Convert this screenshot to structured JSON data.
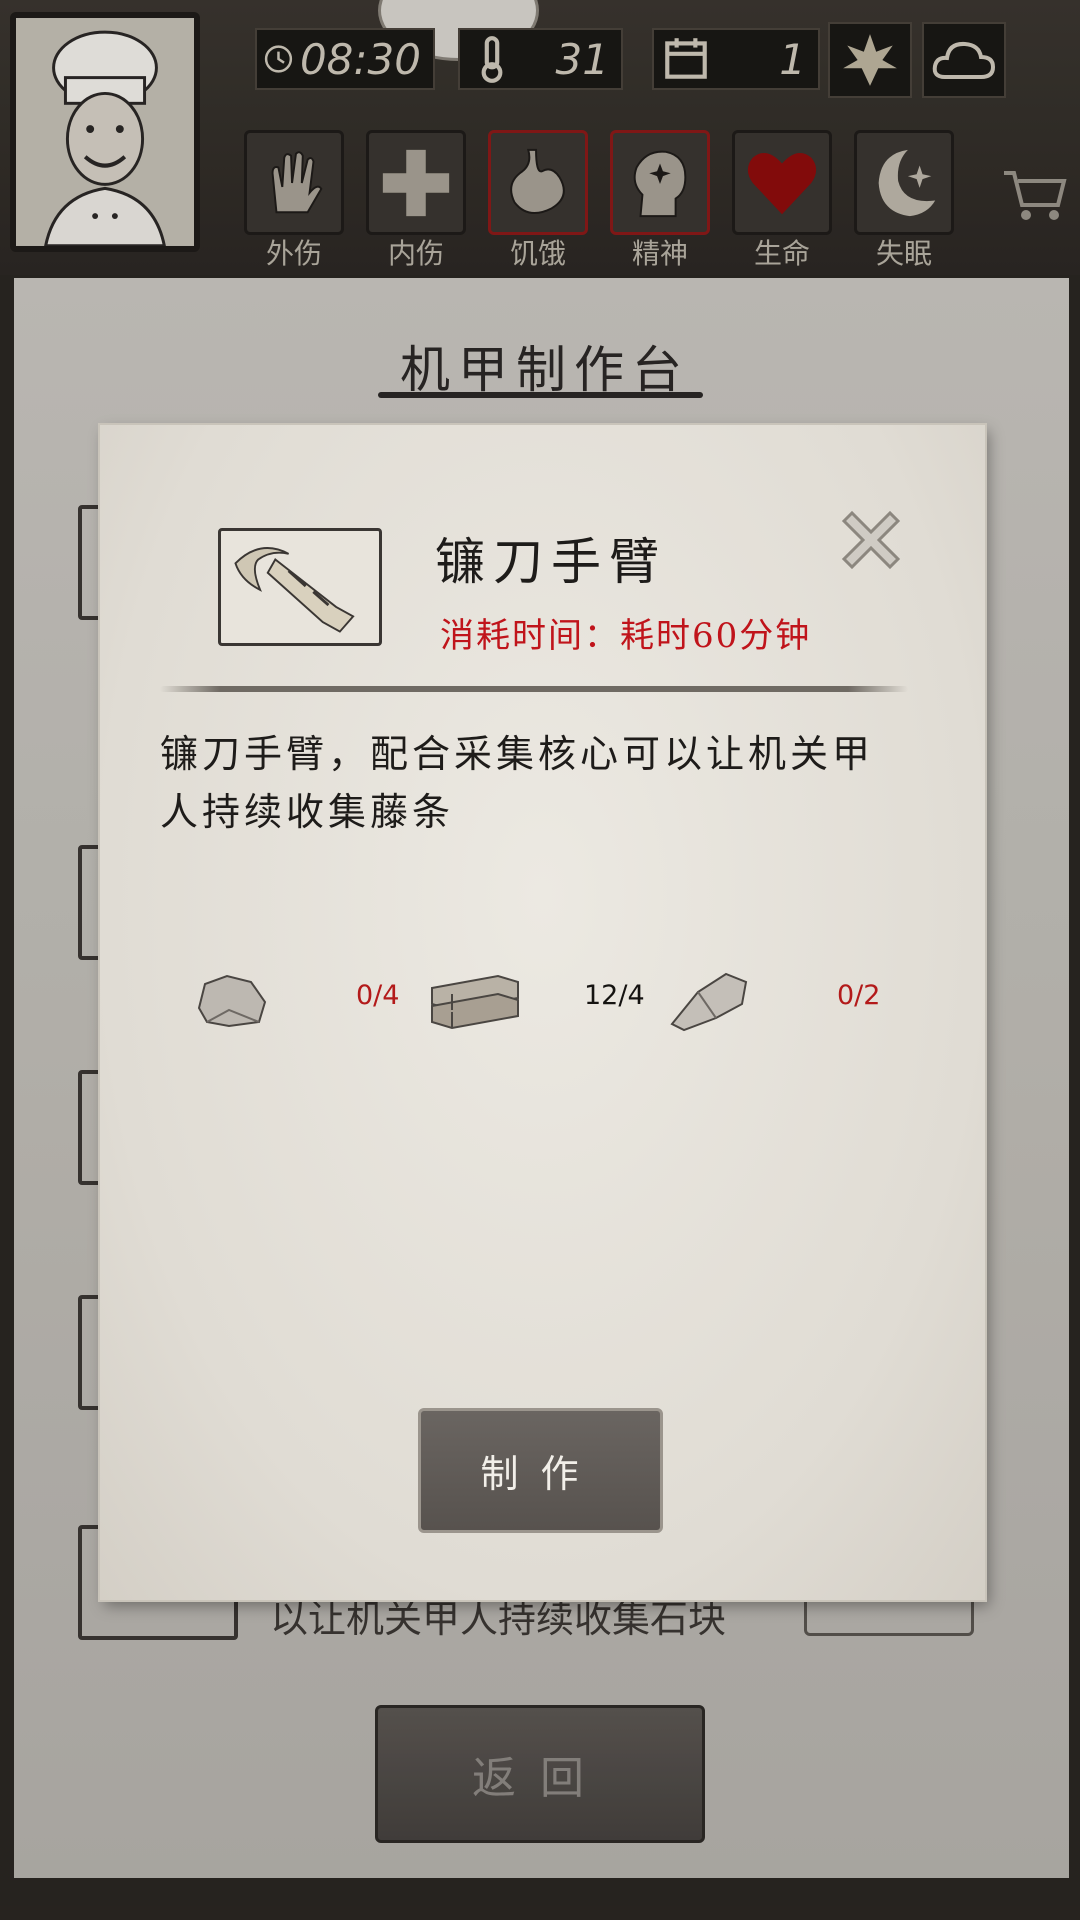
{
  "hud": {
    "time": "08:30",
    "temperature": "31",
    "day": "1",
    "weather_icons": [
      "leaf-icon",
      "cloud-icon"
    ],
    "status_items": [
      {
        "label": "外伤",
        "icon": "hand-icon",
        "alert": false
      },
      {
        "label": "内伤",
        "icon": "cross-icon",
        "alert": false
      },
      {
        "label": "饥饿",
        "icon": "stomach-icon",
        "alert": true
      },
      {
        "label": "精神",
        "icon": "head-sparkle-icon",
        "alert": true
      },
      {
        "label": "生命",
        "icon": "heart-icon",
        "alert": false
      },
      {
        "label": "失眠",
        "icon": "moon-star-icon",
        "alert": false
      }
    ]
  },
  "background": {
    "title": "机甲制作台",
    "partial_row_text": "以让机关甲人持续收集石块",
    "back_label": "返回"
  },
  "dialog": {
    "item_name": "镰刀手臂",
    "craft_time": "消耗时间：耗时60分钟",
    "description": "镰刀手臂，配合采集核心可以让机关甲人持续收集藤条",
    "materials": [
      {
        "icon": "stone-icon",
        "count": "0/4",
        "sufficient": false
      },
      {
        "icon": "wood-planks-icon",
        "count": "12/4",
        "sufficient": true
      },
      {
        "icon": "flint-icon",
        "count": "0/2",
        "sufficient": false
      }
    ],
    "craft_label": "制作"
  },
  "colors": {
    "alert_red": "#c0141b",
    "paper": "#e5e1d9",
    "button_gray": "#5c5753"
  }
}
